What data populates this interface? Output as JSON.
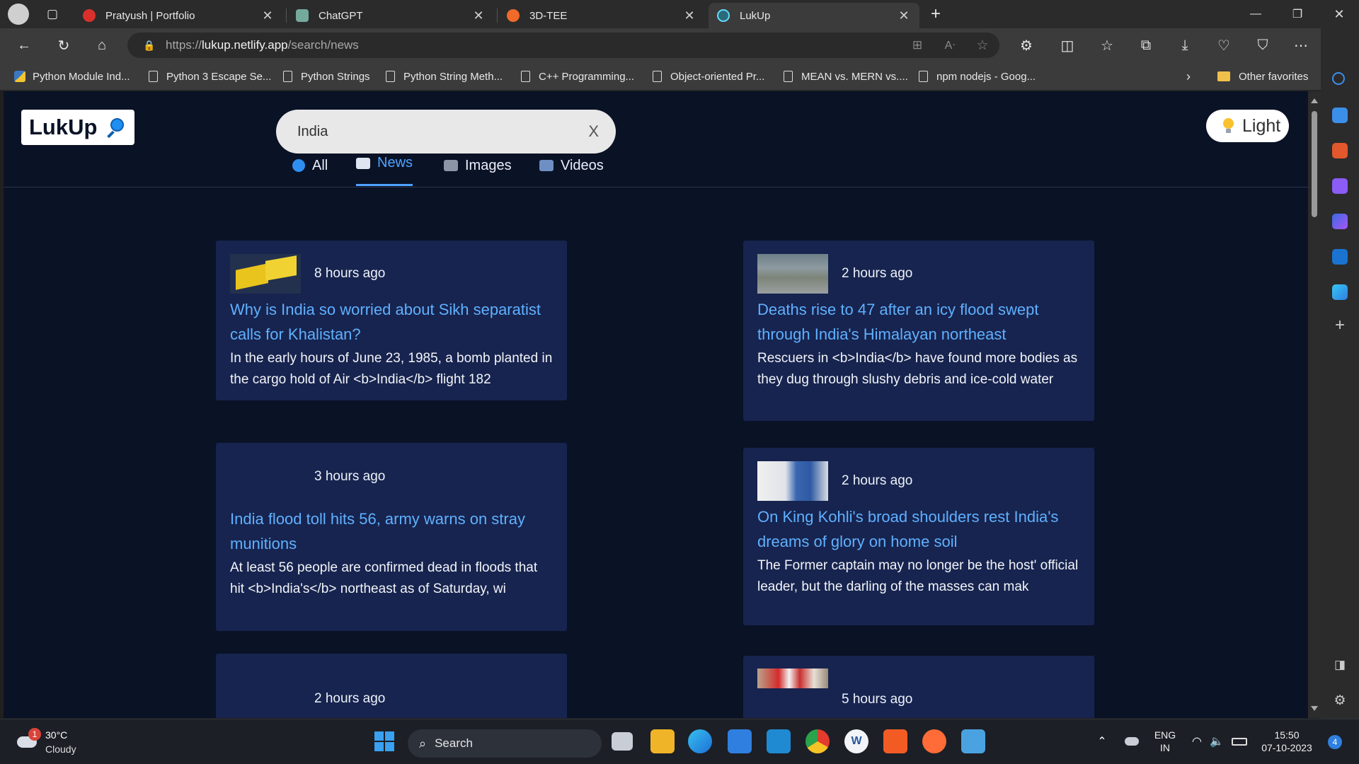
{
  "browser": {
    "tabs": [
      {
        "title": "Pratyush | Portfolio",
        "active": false,
        "favicon_color": "#d9302c"
      },
      {
        "title": "ChatGPT",
        "active": false,
        "favicon_color": "#74aa9c"
      },
      {
        "title": "3D-TEE",
        "active": false,
        "favicon_color": "#f06a2a"
      },
      {
        "title": "LukUp",
        "active": true,
        "favicon_color": "#61dafb"
      }
    ],
    "url_scheme": "https://",
    "url_host": "lukup.netlify.app",
    "url_path": "/search/news",
    "favorites": [
      {
        "label": "Python Module Ind...",
        "icon": "python-icon"
      },
      {
        "label": "Python 3 Escape Se...",
        "icon": "page-icon"
      },
      {
        "label": "Python Strings",
        "icon": "page-icon"
      },
      {
        "label": "Python String Meth...",
        "icon": "page-icon"
      },
      {
        "label": "C++ Programming...",
        "icon": "page-icon"
      },
      {
        "label": "Object-oriented Pr...",
        "icon": "page-icon"
      },
      {
        "label": "MEAN vs. MERN vs....",
        "icon": "page-icon"
      },
      {
        "label": "npm nodejs - Goog...",
        "icon": "page-icon"
      }
    ],
    "other_favorites": "Other favorites"
  },
  "site": {
    "logo": "LukUp",
    "search_value": "India",
    "clear_label": "X",
    "theme_label": "Light",
    "tabs": [
      {
        "label": "All",
        "active": false
      },
      {
        "label": "News",
        "active": true
      },
      {
        "label": "Images",
        "active": false
      },
      {
        "label": "Videos",
        "active": false
      }
    ],
    "cards": [
      {
        "time": "8 hours ago",
        "title": "Why is India so worried about Sikh separatist calls for Khalistan?",
        "description": "In the early hours of June 23, 1985, a bomb planted in the cargo hold of Air <b>India</b> flight 182",
        "has_thumb": true
      },
      {
        "time": "2 hours ago",
        "title": "Deaths rise to 47 after an icy flood swept through India's Himalayan northeast",
        "description": "Rescuers in <b>India</b> have found more bodies as they dug through slushy debris and ice-cold water",
        "has_thumb": true
      },
      {
        "time": "3 hours ago",
        "title": "India flood toll hits 56, army warns on stray munitions",
        "description": "At least 56 people are confirmed dead in floods that hit <b>India's</b> northeast as of Saturday, wi",
        "has_thumb": false
      },
      {
        "time": "2 hours ago",
        "title": "On King Kohli's broad shoulders rest India's dreams of glory on home soil",
        "description": "The Former captain may no longer be the host' official leader, but the darling of the masses can mak",
        "has_thumb": true
      },
      {
        "time": "2 hours ago",
        "title": "",
        "description": "",
        "has_thumb": false
      },
      {
        "time": "5 hours ago",
        "title": "",
        "description": "",
        "has_thumb": true
      }
    ]
  },
  "taskbar": {
    "weather_temp": "30°C",
    "weather_desc": "Cloudy",
    "weather_badge": "1",
    "search_label": "Search",
    "lang_top": "ENG",
    "lang_bottom": "IN",
    "time": "15:50",
    "date": "07-10-2023",
    "notif_count": "4"
  }
}
